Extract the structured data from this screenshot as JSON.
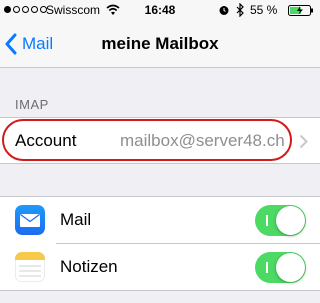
{
  "status_bar": {
    "carrier": "Swisscom",
    "time": "16:48",
    "battery": "55 %",
    "signal_strength": 1
  },
  "nav": {
    "back_label": "Mail",
    "title": "meine Mailbox"
  },
  "section": {
    "header": "IMAP"
  },
  "account": {
    "label": "Account",
    "value": "mailbox@server48.ch"
  },
  "toggles": [
    {
      "label": "Mail",
      "icon": "mail-app-icon",
      "on": true
    },
    {
      "label": "Notizen",
      "icon": "notes-app-icon",
      "on": true
    }
  ],
  "colors": {
    "accent": "#0a7aff",
    "toggle_on": "#4cd964",
    "highlight": "#d21a1a"
  }
}
